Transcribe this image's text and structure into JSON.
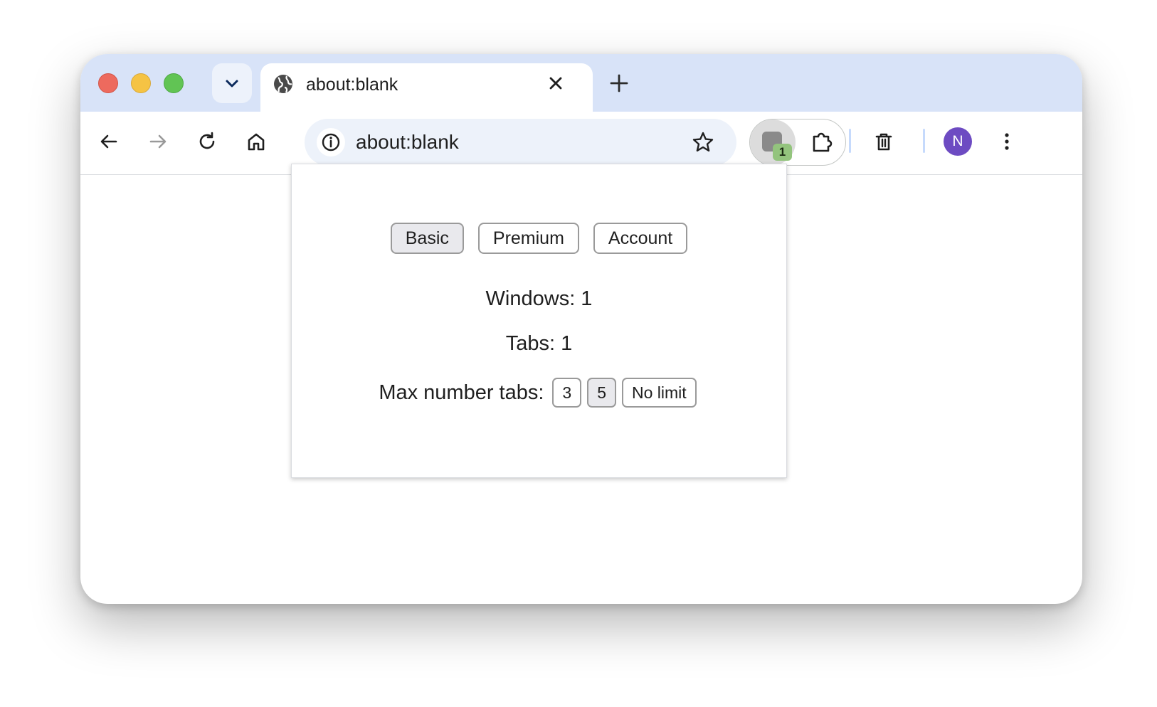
{
  "tab": {
    "title": "about:blank"
  },
  "omnibox": {
    "url": "about:blank"
  },
  "extension": {
    "badge": "1"
  },
  "profile": {
    "initial": "N"
  },
  "popup": {
    "tabs": [
      {
        "label": "Basic",
        "selected": true
      },
      {
        "label": "Premium",
        "selected": false
      },
      {
        "label": "Account",
        "selected": false
      }
    ],
    "windows_text": "Windows: 1",
    "tabs_text": "Tabs: 1",
    "max_label": "Max number tabs:",
    "max_options": [
      {
        "label": "3",
        "selected": false
      },
      {
        "label": "5",
        "selected": true
      },
      {
        "label": "No limit",
        "selected": false
      }
    ]
  },
  "colors": {
    "titlebar": "#d8e3f8",
    "omnibox": "#edf2fa",
    "avatar": "#6d4bc2",
    "badge": "#93c47d"
  }
}
